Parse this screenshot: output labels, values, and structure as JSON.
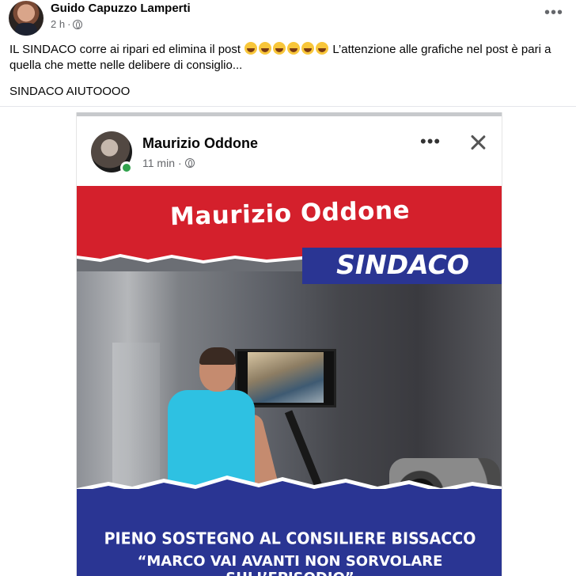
{
  "post": {
    "author": "Guido Capuzzo Lamperti",
    "time": "2 h",
    "text_line1_a": "IL SINDACO corre ai ripari ed elimina il post",
    "text_line1_b": " L’attenzione alle grafiche nel post è pari a quella che mette nelle delibere di consiglio...",
    "text_line2": "SINDACO AIUTOOOO",
    "emoji_count": 6,
    "emoji_icon": "laughing-tears-emoji",
    "more_icon": "more-options-icon"
  },
  "embedded": {
    "author": "Maurizio Oddone",
    "time": "11 min",
    "status_color": "#31a24c",
    "close_icon": "close-icon",
    "poster": {
      "title": "Maurizio Oddone",
      "role": "SINDACO",
      "line1": "PIENO SOSTEGNO AL CONSILIERE BISSACCO",
      "line2": "“MARCO VAI AVANTI NON SORVOLARE SULL’EPISODIO”",
      "red": "#d4202c",
      "blue": "#2a3593"
    }
  }
}
